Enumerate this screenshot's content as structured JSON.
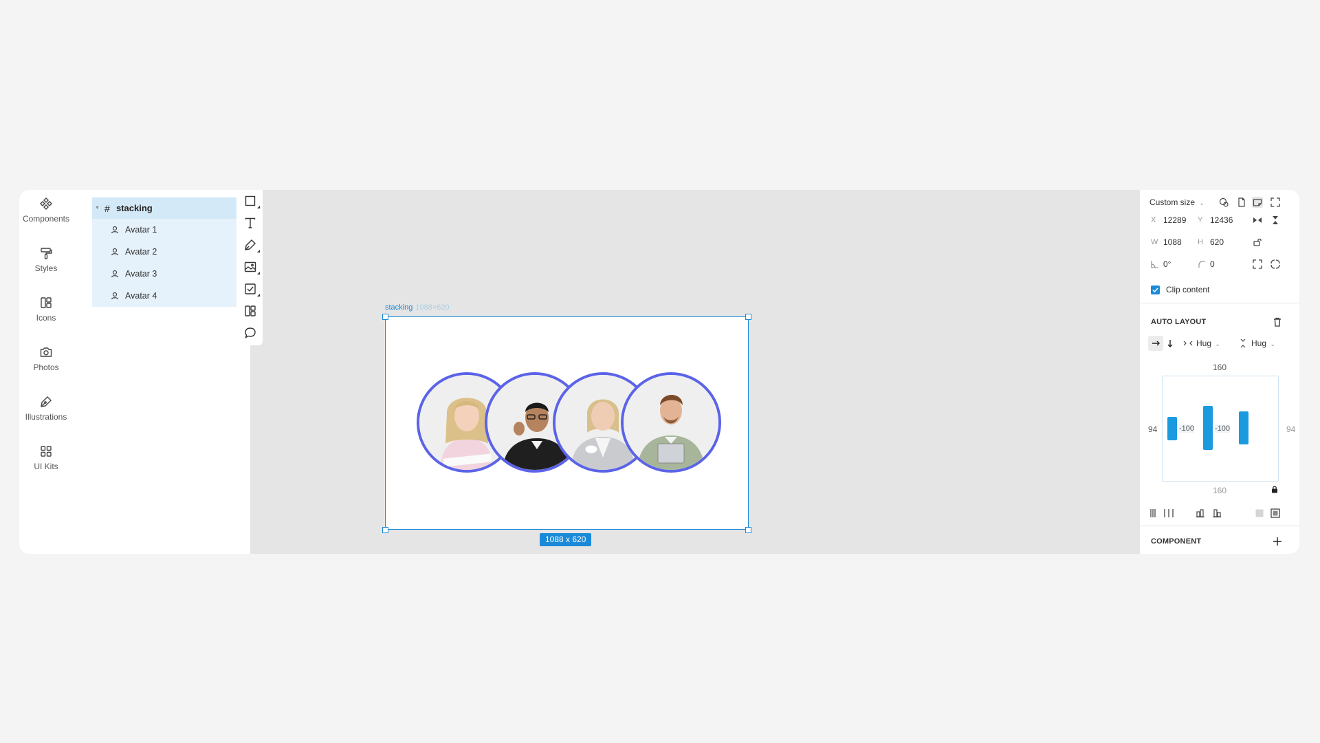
{
  "left_rail": {
    "items": [
      {
        "label": "Components",
        "icon": "components-icon"
      },
      {
        "label": "Styles",
        "icon": "paint-roller-icon"
      },
      {
        "label": "Icons",
        "icon": "icons-icon"
      },
      {
        "label": "Photos",
        "icon": "camera-icon"
      },
      {
        "label": "Illustrations",
        "icon": "pen-nib-icon"
      },
      {
        "label": "UI Kits",
        "icon": "grid-icon"
      }
    ]
  },
  "layers": {
    "root": {
      "name": "stacking",
      "icon": "frame-hash-icon"
    },
    "children": [
      {
        "name": "Avatar 1",
        "icon": "user-icon"
      },
      {
        "name": "Avatar 2",
        "icon": "user-icon"
      },
      {
        "name": "Avatar 3",
        "icon": "user-icon"
      },
      {
        "name": "Avatar 4",
        "icon": "user-icon"
      }
    ]
  },
  "toolbar": {
    "tools": [
      "rectangle-tool-icon",
      "text-tool-icon",
      "pen-tool-icon",
      "image-tool-icon",
      "checkbox-tool-icon",
      "components-tool-icon",
      "comment-tool-icon"
    ]
  },
  "canvas": {
    "frame_name": "stacking",
    "frame_dims": "1088×620",
    "size_badge": "1088 x 620",
    "selection_color": "#1a8ad8",
    "avatar_ring_color": "#5b63e8"
  },
  "properties": {
    "size_preset": "Custom size",
    "x_label": "X",
    "x_value": "12289",
    "y_label": "Y",
    "y_value": "12436",
    "w_label": "W",
    "w_value": "1088",
    "h_label": "H",
    "h_value": "620",
    "rotation_value": "0°",
    "radius_value": "0",
    "clip_content_label": "Clip content",
    "clip_content_checked": true,
    "auto_layout": {
      "title": "AUTO LAYOUT",
      "width_mode": "Hug",
      "height_mode": "Hug",
      "padding_top": "160",
      "padding_bottom": "160",
      "padding_left": "94",
      "padding_right": "94",
      "gap_1": "-100",
      "gap_2": "-100"
    },
    "component_title": "COMPONENT"
  }
}
